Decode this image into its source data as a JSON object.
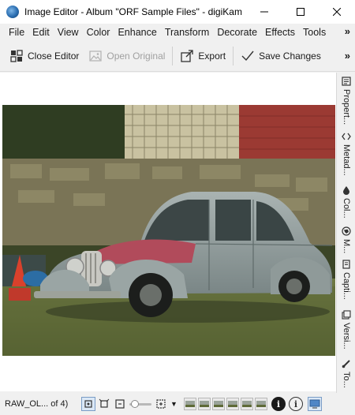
{
  "window": {
    "title": "Image Editor - Album \"ORF Sample Files\" - digiKam",
    "app_icon": "digikam-icon"
  },
  "menu": {
    "items": [
      "File",
      "Edit",
      "View",
      "Color",
      "Enhance",
      "Transform",
      "Decorate",
      "Effects",
      "Tools"
    ],
    "more": "»"
  },
  "toolbar": {
    "close_editor": "Close Editor",
    "open_original": "Open Original",
    "export": "Export",
    "save_changes": "Save Changes",
    "more": "»"
  },
  "right_tabs": [
    "Propert...",
    "Metad...",
    "Col...",
    "M...",
    "Capti...",
    "Versi...",
    "To..."
  ],
  "status": {
    "text": "RAW_OL... of 4)"
  }
}
